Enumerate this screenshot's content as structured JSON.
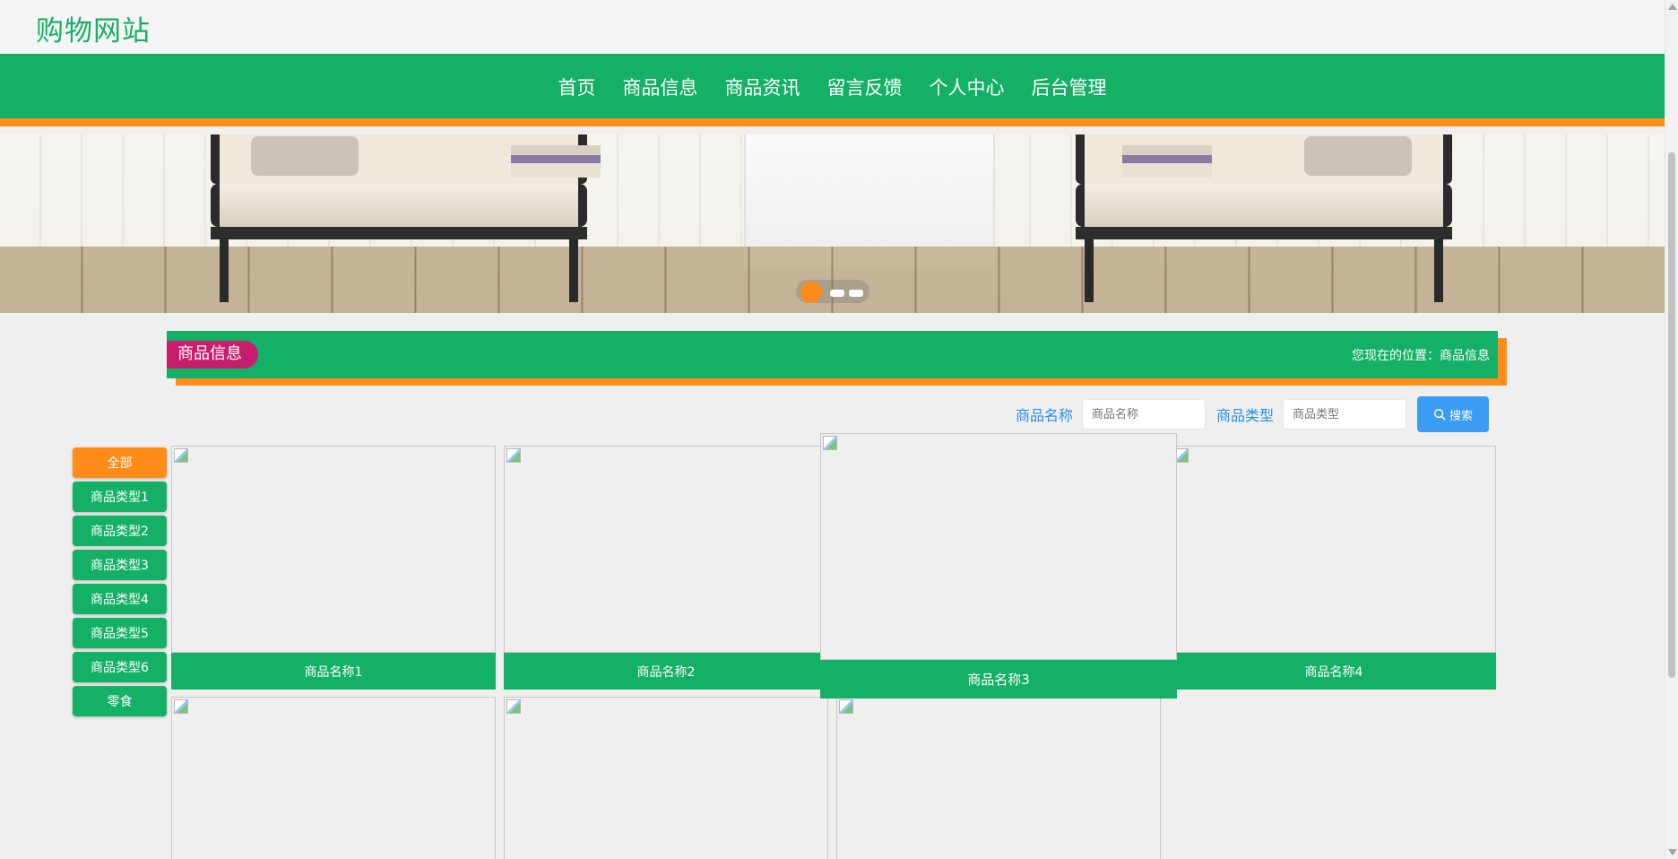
{
  "site": {
    "title": "购物网站"
  },
  "nav": {
    "items": [
      {
        "label": "首页"
      },
      {
        "label": "商品信息"
      },
      {
        "label": "商品资讯"
      },
      {
        "label": "留言反馈"
      },
      {
        "label": "个人中心"
      },
      {
        "label": "后台管理"
      }
    ]
  },
  "banner": {
    "slide_count": 3,
    "active_slide": 1
  },
  "section": {
    "title": "商品信息",
    "breadcrumb": "您现在的位置：商品信息"
  },
  "search": {
    "name_label": "商品名称",
    "name_placeholder": "商品名称",
    "type_label": "商品类型",
    "type_placeholder": "商品类型",
    "button_label": "搜索"
  },
  "categories": [
    {
      "label": "全部",
      "active": true
    },
    {
      "label": "商品类型1"
    },
    {
      "label": "商品类型2"
    },
    {
      "label": "商品类型3"
    },
    {
      "label": "商品类型4"
    },
    {
      "label": "商品类型5"
    },
    {
      "label": "商品类型6"
    },
    {
      "label": "零食"
    }
  ],
  "products": [
    {
      "name": "商品名称1"
    },
    {
      "name": "商品名称2"
    },
    {
      "name": "商品名称3"
    },
    {
      "name": "商品名称4"
    },
    {
      "name": ""
    },
    {
      "name": ""
    },
    {
      "name": ""
    }
  ],
  "colors": {
    "primary_green": "#14b066",
    "accent_orange": "#ff8c19",
    "tag_magenta": "#c81d6f",
    "search_blue": "#3a9cf3",
    "label_blue": "#2a8fe6"
  }
}
